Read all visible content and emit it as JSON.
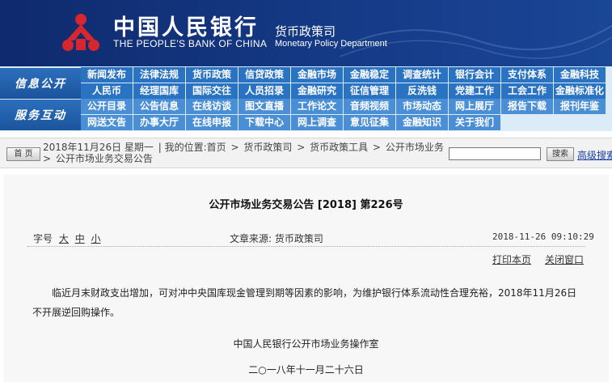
{
  "header": {
    "cn_name": "中国人民银行",
    "en_name": "THE PEOPLE'S BANK OF CHINA",
    "dept_cn": "货币政策司",
    "dept_en": "Monetary Policy Department"
  },
  "nav": {
    "section1": "信息公开",
    "section2": "服务互动",
    "row1": [
      "新闻发布",
      "法律法规",
      "货币政策",
      "信贷政策",
      "金融市场",
      "金融稳定",
      "调查统计",
      "银行会计",
      "支付体系",
      "金融科技"
    ],
    "row2": [
      "人民币",
      "经理国库",
      "国际交往",
      "人员招录",
      "金融研究",
      "征信管理",
      "反洗钱",
      "党建工作",
      "工会工作",
      "金融标准化"
    ],
    "row3": [
      "公开目录",
      "公告信息",
      "在线访谈",
      "图文直播",
      "工作论文",
      "音频视频",
      "市场动态",
      "网上展厅",
      "报告下载",
      "报刊年鉴"
    ],
    "row4": [
      "网送文告",
      "办事大厅",
      "在线申报",
      "下载中心",
      "网上调查",
      "意见征集",
      "金融知识",
      "关于我们"
    ]
  },
  "breadcrumb": {
    "home_label": "首 页",
    "date": "2018年11月26日 星期一",
    "location_label": "我的位置:首页",
    "sep": ">",
    "items": [
      "货币政策司",
      "货币政策工具",
      "公开市场业务",
      "公开市场业务交易公告"
    ],
    "search_placeholder": "",
    "search_button": "搜索",
    "advanced_search": "高级搜索"
  },
  "article": {
    "title": "公开市场业务交易公告 [2018] 第226号",
    "size_label": "字号",
    "size_large": "大",
    "size_medium": "中",
    "size_small": "小",
    "source": "文章来源: 货币政策司",
    "datetime": "2018-11-26 09:10:29",
    "print": "打印本页",
    "close": "关闭窗口",
    "body": "临近月末财政支出增加，可对冲中央国库现金管理到期等因素的影响，为维护银行体系流动性合理充裕，2018年11月26日不开展逆回购操作。",
    "signature_org": "中国人民银行公开市场业务操作室",
    "signature_date": "二○一八年十一月二十六日"
  },
  "colors": {
    "banner": "#153a86",
    "nav_button": "#2a73c2",
    "link": "#1a3fa0"
  }
}
